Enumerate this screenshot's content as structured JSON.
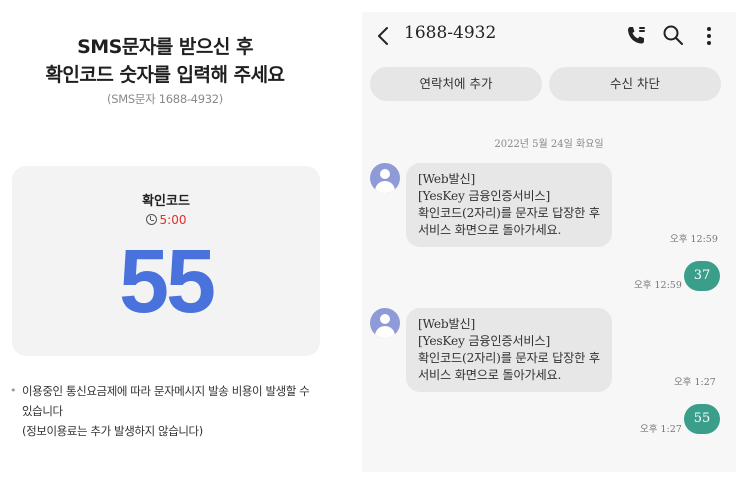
{
  "left_panel": {
    "title_line1": "SMS문자를 받으신 후",
    "title_line2": "확인코드 숫자를 입력해 주세요",
    "subtitle": "(SMS문자 1688-4932)",
    "card": {
      "label": "확인코드",
      "timer": "5:00",
      "code": "55"
    },
    "notice": {
      "bullet": "•",
      "line1": "이용중인 통신요금제에 따라 문자메시지 발송 비용이 발생할 수",
      "line2": "있습니다",
      "line3": "(정보이용료는 추가 발생하지 않습니다)"
    }
  },
  "phone": {
    "header": {
      "number": "1688-4932",
      "icons": [
        "back-icon",
        "call-icon",
        "search-icon",
        "more-icon"
      ]
    },
    "actions": {
      "add_contact": "연락처에 추가",
      "block": "수신 차단"
    },
    "date": "2022년 5월 24일 화요일",
    "messages": [
      {
        "direction": "incoming",
        "lines": [
          "[Web발신]",
          "[YesKey 금융인증서비스]",
          "확인코드(2자리)를 문자로 답장한 후",
          "서비스 화면으로 돌아가세요."
        ],
        "time": "오후 12:59"
      },
      {
        "direction": "outgoing",
        "text": "37",
        "time": "오후 12:59"
      },
      {
        "direction": "incoming",
        "lines": [
          "[Web발신]",
          "[YesKey 금융인증서비스]",
          "확인코드(2자리)를 문자로 답장한 후",
          "서비스 화면으로 돌아가세요."
        ],
        "time": "오후 1:27"
      },
      {
        "direction": "outgoing",
        "text": "55",
        "time": "오후 1:27"
      }
    ]
  },
  "colors": {
    "code_blue": "#4a72dc",
    "timer_red": "#e0312b",
    "outgoing_bubble": "#3a9e8b",
    "avatar": "#8e9bd6"
  }
}
